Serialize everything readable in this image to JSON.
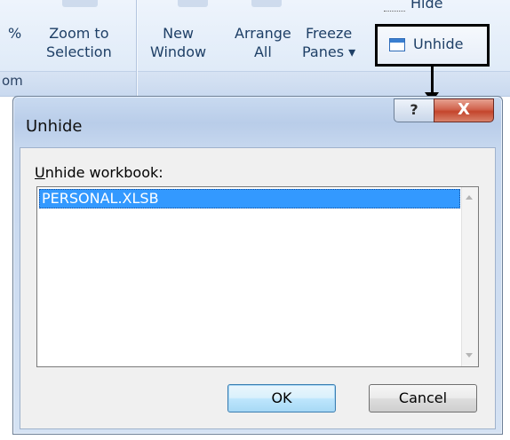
{
  "ribbon": {
    "zoom_group": {
      "percent_label": "%",
      "zoom_to_selection": {
        "line1": "Zoom to",
        "line2": "Selection"
      },
      "group_label": "om"
    },
    "window_group": {
      "new_window": {
        "line1": "New",
        "line2": "Window"
      },
      "arrange_all": {
        "line1": "Arrange",
        "line2": "All"
      },
      "freeze_panes": {
        "line1": "Freeze",
        "line2": "Panes ▾"
      },
      "hide_label": "Hide",
      "unhide_label": "Unhide"
    }
  },
  "dialog": {
    "title": "Unhide",
    "help_glyph": "?",
    "close_glyph": "X",
    "list_label_accel": "U",
    "list_label_rest": "nhide workbook:",
    "items": [
      {
        "label": "PERSONAL.XLSB",
        "selected": true
      }
    ],
    "ok_label": "OK",
    "cancel_label": "Cancel"
  },
  "colors": {
    "selection": "#3399ff",
    "callout_border": "#000000",
    "close_button": "#c4452c",
    "ribbon_text": "#1e3f66"
  },
  "icons": {
    "help": "help-icon",
    "close": "close-icon",
    "unhide": "window-icon",
    "scroll_up": "chevron-up-icon",
    "scroll_down": "chevron-down-icon"
  }
}
